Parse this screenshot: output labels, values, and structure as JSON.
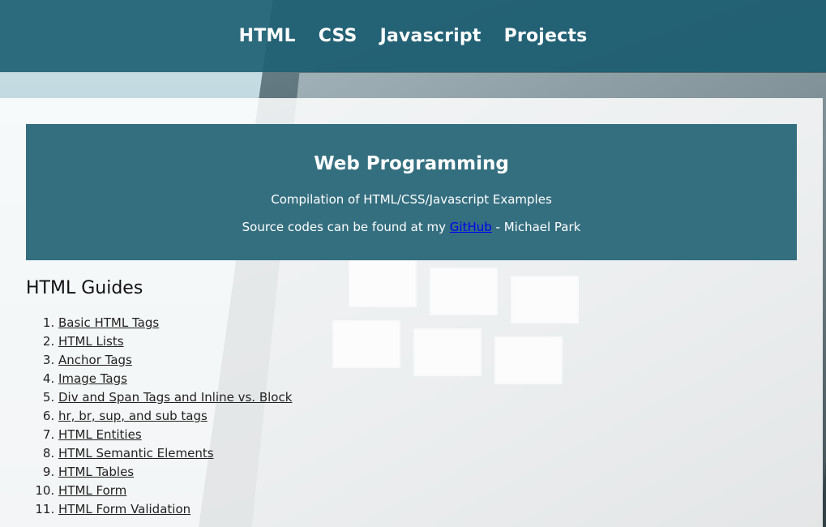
{
  "nav": {
    "items": [
      {
        "label": "HTML"
      },
      {
        "label": "CSS"
      },
      {
        "label": "Javascript"
      },
      {
        "label": "Projects"
      }
    ]
  },
  "hero": {
    "title": "Web Programming",
    "subtitle": "Compilation of HTML/CSS/Javascript Examples",
    "source_prefix": "Source codes can be found at my ",
    "source_link": "GitHub",
    "source_suffix": " - Michael Park"
  },
  "guides": {
    "title": "HTML Guides",
    "items": [
      {
        "label": "Basic HTML Tags"
      },
      {
        "label": "HTML Lists"
      },
      {
        "label": "Anchor Tags"
      },
      {
        "label": "Image Tags"
      },
      {
        "label": "Div and Span Tags and Inline vs. Block"
      },
      {
        "label": "hr, br, sup, and sub tags"
      },
      {
        "label": "HTML Entities"
      },
      {
        "label": "HTML Semantic Elements"
      },
      {
        "label": "HTML Tables"
      },
      {
        "label": "HTML Form"
      },
      {
        "label": "HTML Form Validation"
      }
    ]
  },
  "colors": {
    "navbar": "#1e6074",
    "hero": "#346f80",
    "link": "#0000ee"
  }
}
